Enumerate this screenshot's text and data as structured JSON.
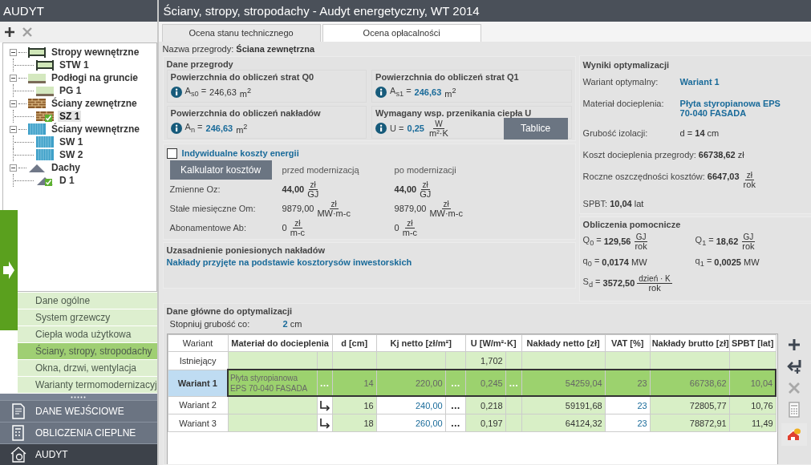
{
  "sidebar": {
    "title": "AUDYT",
    "tree": [
      {
        "label": "Stropy wewnętrzne",
        "kind": "ceiling",
        "expanded": true,
        "children": [
          {
            "label": "STW 1",
            "kind": "ceiling",
            "selected": false,
            "complete": false
          }
        ]
      },
      {
        "label": "Podłogi na gruncie",
        "kind": "floor",
        "expanded": true,
        "children": [
          {
            "label": "PG 1",
            "kind": "floor",
            "selected": false,
            "complete": false
          }
        ]
      },
      {
        "label": "Ściany zewnętrzne",
        "kind": "brick",
        "expanded": true,
        "children": [
          {
            "label": "SZ 1",
            "kind": "brick",
            "selected": true,
            "complete": true
          }
        ]
      },
      {
        "label": "Ściany wewnętrzne",
        "kind": "inner",
        "expanded": true,
        "children": [
          {
            "label": "SW 1",
            "kind": "inner",
            "selected": false,
            "complete": false
          },
          {
            "label": "SW 2",
            "kind": "inner",
            "selected": false,
            "complete": false
          }
        ]
      },
      {
        "label": "Dachy",
        "kind": "roof",
        "expanded": true,
        "children": [
          {
            "label": "D 1",
            "kind": "roof",
            "selected": false,
            "complete": true
          }
        ]
      }
    ],
    "menu": [
      {
        "label": "Dane ogólne",
        "selected": false
      },
      {
        "label": "System grzewczy",
        "selected": false
      },
      {
        "label": "Ciepła woda użytkowa",
        "selected": false
      },
      {
        "label": "Ściany, stropy, stropodachy",
        "selected": true
      },
      {
        "label": "Okna, drzwi, wentylacja",
        "selected": false
      },
      {
        "label": "Warianty termomodernizacyj",
        "selected": false
      }
    ],
    "nav": [
      {
        "label": "DANE WEJŚCIOWE",
        "kind": "input",
        "selected": false
      },
      {
        "label": "OBLICZENIA CIEPLNE",
        "kind": "calc",
        "selected": false
      },
      {
        "label": "AUDYT",
        "kind": "audit",
        "selected": true
      }
    ]
  },
  "window": {
    "title": "Ściany, stropy, stropodachy - Audyt energetyczny, WT 2014"
  },
  "tabs": [
    {
      "label": "Ocena stanu technicznego",
      "selected": false
    },
    {
      "label": "Ocena opłacalności",
      "selected": true
    }
  ],
  "partition_name": {
    "label": "Nazwa przegrody:",
    "value": "Ściana zewnętrzna"
  },
  "partition_data": {
    "title": "Dane przegrody",
    "boxes": [
      {
        "title": "Powierzchnia do obliczeń strat Q0",
        "symbol": "A$_{s0}$ =",
        "value": "246,63",
        "unit": "m$^{2}$",
        "highlight": false
      },
      {
        "title": "Powierzchnia do obliczeń strat Q1",
        "symbol": "A$_{s1}$ =",
        "value": "246,63",
        "unit": "m$^{2}$",
        "highlight": true
      },
      {
        "title": "Powierzchnia do obliczeń nakładów",
        "symbol": "A$_{n}$ =",
        "value": "246,63",
        "unit": "m$^{2}$",
        "highlight": true
      },
      {
        "title": "Wymagany wsp. przenikania ciepła U",
        "symbol": "U =",
        "value": "0,25",
        "unit": {
          "num": "W",
          "den": "m²·K"
        },
        "highlight": true,
        "button": "Tablice"
      }
    ]
  },
  "energy": {
    "checkbox": {
      "label": "Indywidualne koszty energii",
      "checked": false
    },
    "button": "Kalkulator kosztów",
    "headers": [
      "przed modernizacją",
      "po modernizacji"
    ],
    "rows": [
      {
        "label": "Zmienne Oz:",
        "values": [
          {
            "value": "44,00",
            "unit": {
              "num": "zł",
              "den": "GJ"
            },
            "bold": true
          },
          {
            "value": "44,00",
            "unit": {
              "num": "zł",
              "den": "GJ"
            },
            "bold": true
          }
        ]
      },
      {
        "label": "Stałe miesięczne Om:",
        "values": [
          {
            "value": "9879,00",
            "unit": {
              "num": "zł",
              "den": "MW·m-c"
            },
            "bold": false
          },
          {
            "value": "9879,00",
            "unit": {
              "num": "zł",
              "den": "MW·m-c"
            },
            "bold": false
          }
        ]
      },
      {
        "label": "Abonamentowe Ab:",
        "values": [
          {
            "value": "0",
            "unit": {
              "num": "zł",
              "den": "m-c"
            },
            "bold": false
          },
          {
            "value": "0",
            "unit": {
              "num": "zł",
              "den": "m-c"
            },
            "bold": false
          }
        ]
      }
    ]
  },
  "justification": {
    "title": "Uzasadnienie poniesionych nakładów",
    "text": "Nakłady przyjęte na podstawie kosztorysów inwestorskich"
  },
  "results": {
    "title": "Wyniki optymalizacji",
    "items": [
      {
        "kind": "link",
        "label": "Wariant optymalny:",
        "value": "Wariant 1"
      },
      {
        "kind": "link",
        "label": "Materiał docieplenia:",
        "value": "Płyta styropianowa EPS 70-040 FASADA"
      },
      {
        "kind": "aligned",
        "label": "Grubość izolacji:",
        "value": "d = **14**",
        "unit": "cm"
      },
      {
        "kind": "inline",
        "label": "Koszt docieplenia przegrody:",
        "value": "66738,62",
        "unit": "zł"
      },
      {
        "kind": "inline",
        "label": "Roczne oszczędności kosztów:",
        "value": "6647,03",
        "unit": {
          "num": "zł",
          "den": "rok"
        }
      },
      {
        "kind": "inline",
        "label": "SPBT:",
        "value": "10,04",
        "unit": "lat"
      }
    ]
  },
  "auxiliary": {
    "title": "Obliczenia pomocnicze",
    "items": [
      {
        "symbol": "Q$_{0}$ =",
        "value": "129,56",
        "unit": {
          "num": "GJ",
          "den": "rok"
        }
      },
      {
        "symbol": "Q$_{1}$ =",
        "value": "18,62",
        "unit": {
          "num": "GJ",
          "den": "rok"
        }
      },
      {
        "symbol": "q$_{0}$ =",
        "value": "0,0174",
        "unit": "MW"
      },
      {
        "symbol": "q$_{1}$ =",
        "value": "0,0025",
        "unit": "MW"
      },
      {
        "symbol": "S$_{d}$ =",
        "value": "3572,50",
        "unit": {
          "num": "dzień · K",
          "den": "rok"
        }
      }
    ]
  },
  "optimization": {
    "title": "Dane główne do optymalizacji",
    "step": {
      "label": "Stopniuj grubość co:",
      "value": "2",
      "unit": "cm"
    },
    "table": {
      "columns": [
        {
          "label": "Wariant",
          "bold": false
        },
        {
          "label": "Materiał do docieplenia",
          "bold": true
        },
        {
          "label": "d [cm]",
          "bold": true
        },
        {
          "label": "Kj netto [zł/m²]",
          "bold": true
        },
        {
          "label": "U [W/m²·K]",
          "bold": true
        },
        {
          "label": "Nakłady netto [zł]",
          "bold": true
        },
        {
          "label": "VAT [%]",
          "bold": true
        },
        {
          "label": "Nakłady brutto [zł]",
          "bold": true
        },
        {
          "label": "SPBT [lat]",
          "bold": true
        }
      ],
      "rows": [
        {
          "label": "Istniejący",
          "kind": "existing",
          "selected": false,
          "inherits": false,
          "u": "1,702"
        },
        {
          "label": "Wariant 1",
          "kind": "variant",
          "selected": true,
          "inherits": false,
          "material": "Płyta styropianowa EPS 70-040 FASADA",
          "material_button": "…",
          "d": "14",
          "kj": "220,00",
          "kj_button": "…",
          "u": "0,245",
          "u_button": "…",
          "netto": "54259,04",
          "vat": "23",
          "brutto": "66738,62",
          "spbt": "10,04"
        },
        {
          "label": "Wariant 2",
          "kind": "variant",
          "selected": false,
          "inherits": true,
          "d": "16",
          "kj": "240,00",
          "kj_button": "…",
          "u": "0,218",
          "netto": "59191,68",
          "vat": "23",
          "brutto": "72805,77",
          "spbt": "10,76"
        },
        {
          "label": "Wariant 3",
          "kind": "variant",
          "selected": false,
          "inherits": true,
          "d": "18",
          "kj": "260,00",
          "kj_button": "…",
          "u": "0,197",
          "netto": "64124,32",
          "vat": "23",
          "brutto": "78872,91",
          "spbt": "11,49"
        }
      ]
    }
  }
}
